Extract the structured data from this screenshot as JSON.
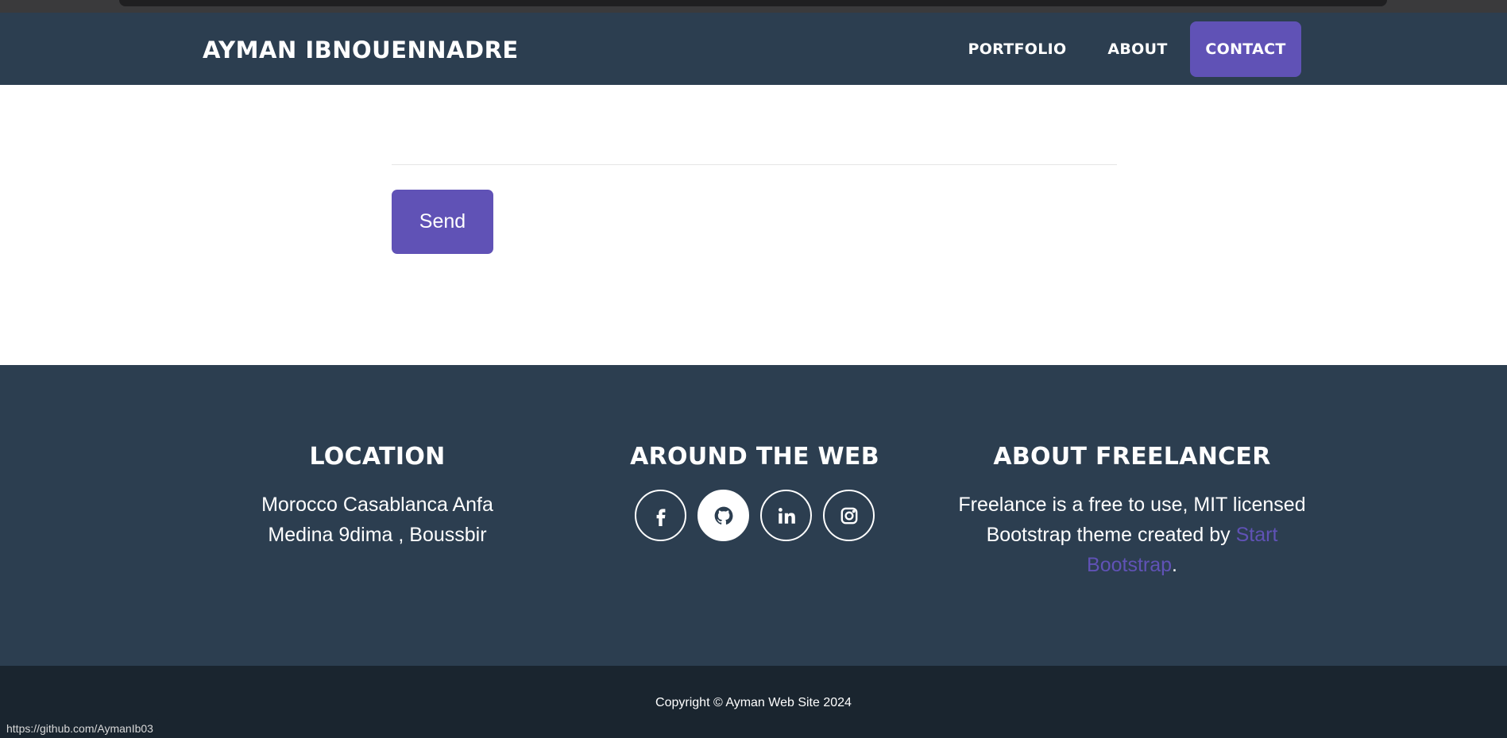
{
  "navbar": {
    "brand": "AYMAN IBNOUENNADRE",
    "links": [
      {
        "label": "PORTFOLIO"
      },
      {
        "label": "ABOUT"
      },
      {
        "label": "CONTACT",
        "active": true
      }
    ]
  },
  "form": {
    "send_label": "Send"
  },
  "footer": {
    "location": {
      "title": "LOCATION",
      "line1": "Morocco Casablanca Anfa",
      "line2": "Medina 9dima , Boussbir"
    },
    "web": {
      "title": "AROUND THE WEB",
      "icons": [
        "facebook-icon",
        "github-icon",
        "linkedin-icon",
        "instagram-icon"
      ]
    },
    "about": {
      "title": "ABOUT FREELANCER",
      "text_before": "Freelance is a free to use, MIT licensed Bootstrap theme created by ",
      "link": "Start Bootstrap",
      "text_after": "."
    }
  },
  "copyright": "Copyright © Ayman Web Site 2024",
  "status_url": "https://github.com/AymanIb03",
  "colors": {
    "primary": "#2c3e50",
    "accent": "#6052b6",
    "footer_bottom": "#1a252f"
  }
}
